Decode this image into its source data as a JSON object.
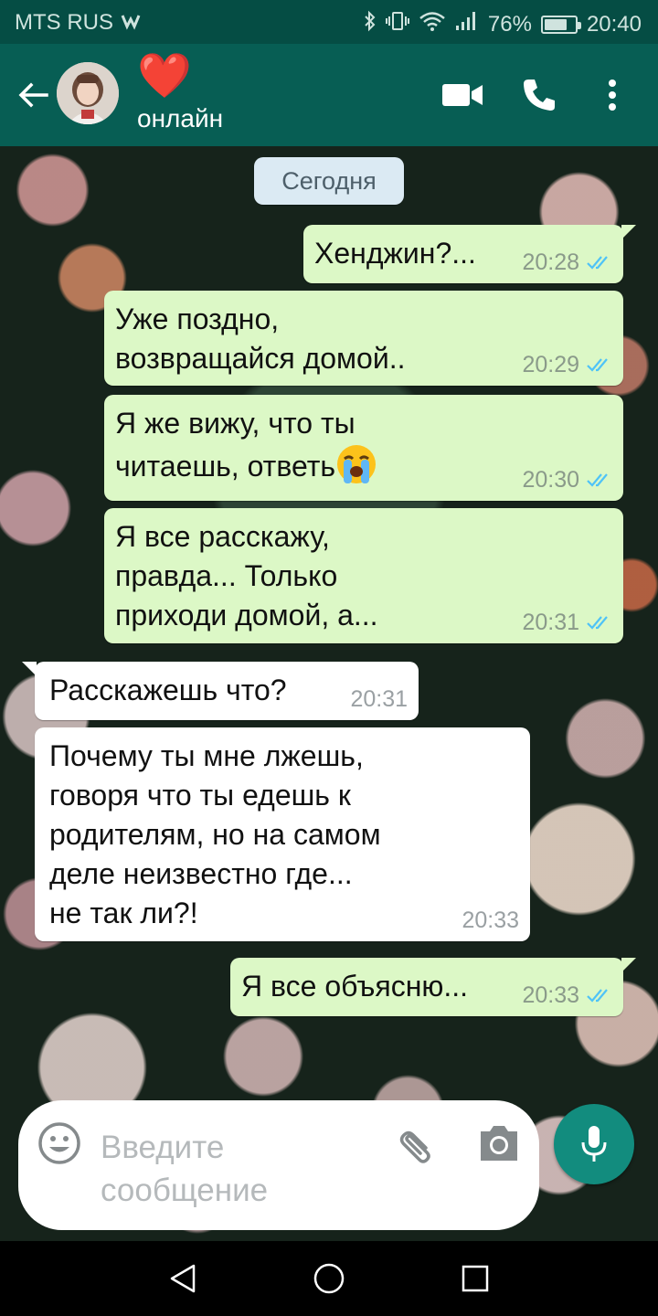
{
  "status_bar": {
    "carrier": "MTS RUS",
    "battery": "76%",
    "battery_level": 0.76,
    "time": "20:40"
  },
  "header": {
    "contact_name": "❤️",
    "contact_status": "онлайн"
  },
  "chat": {
    "date_label": "Сегодня",
    "messages": [
      {
        "direction": "out",
        "text": "Хенджин?...",
        "time": "20:28"
      },
      {
        "direction": "out",
        "text": "Уже поздно,\nвозвращайся домой..",
        "time": "20:29"
      },
      {
        "direction": "out",
        "text": "Я же вижу, что ты\nчитаешь, ответь",
        "emoji": "loudly-crying-face",
        "time": "20:30"
      },
      {
        "direction": "out",
        "text": "Я все расскажу,\nправда... Только\nприходи домой, а...",
        "time": "20:31"
      },
      {
        "direction": "in",
        "text": "Расскажешь что?",
        "time": "20:31"
      },
      {
        "direction": "in",
        "text": "Почему ты мне лжешь,\nговоря что ты едешь к\nродителям, но на самом\nделе неизвестно где...\nне так ли?!",
        "time": "20:33"
      },
      {
        "direction": "out",
        "text": "Я все объясню...",
        "time": "20:33"
      }
    ]
  },
  "composer": {
    "placeholder": "Введите\nсообщение"
  },
  "colors": {
    "header": "#075e54",
    "status_bar": "#054d44",
    "outgoing_bubble": "#dcf8c6",
    "incoming_bubble": "#ffffff",
    "read_ticks": "#4fc3f7",
    "accent": "#128c7e"
  },
  "icons": [
    "back-arrow-icon",
    "video-call-icon",
    "phone-icon",
    "more-vert-icon",
    "emoji-icon",
    "attach-icon",
    "camera-icon",
    "mic-icon",
    "nav-back-icon",
    "nav-home-icon",
    "nav-recents-icon",
    "bluetooth-icon",
    "vibrate-icon",
    "wifi-icon",
    "signal-icon",
    "battery-icon",
    "whatsapp-logo-icon"
  ]
}
